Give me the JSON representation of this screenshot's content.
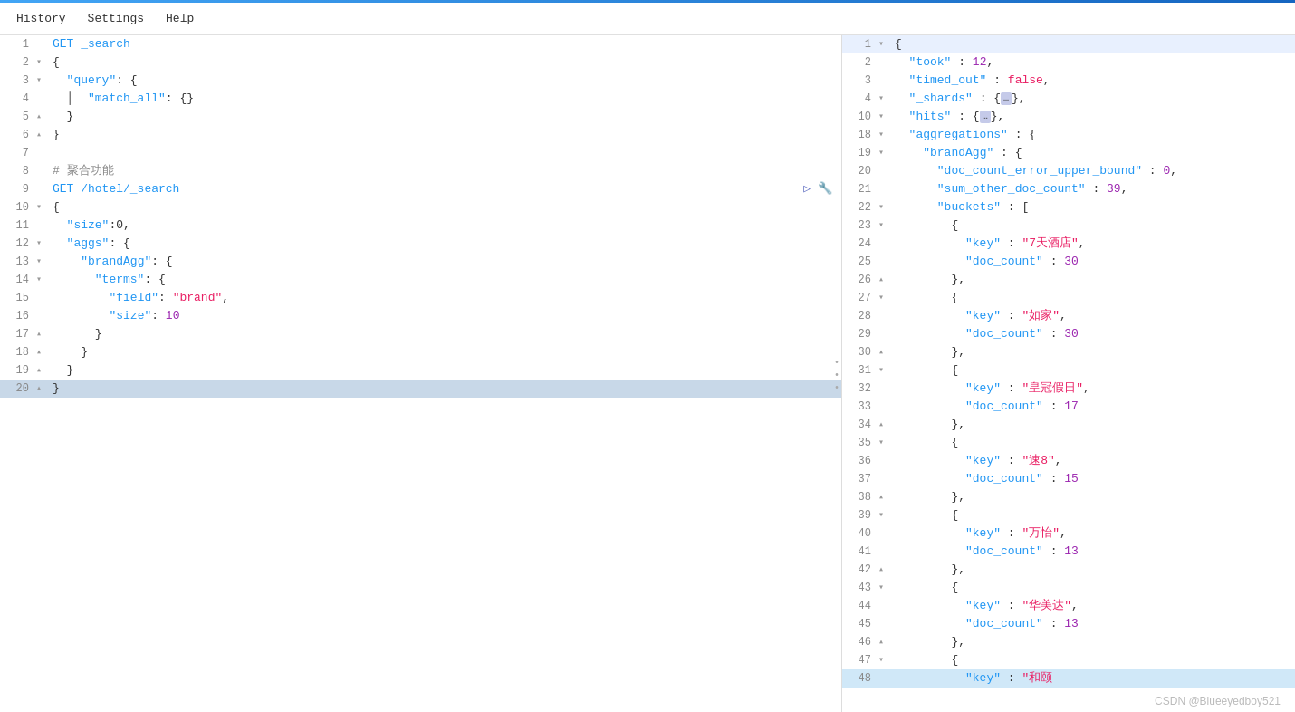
{
  "menu": {
    "items": [
      "History",
      "Settings",
      "Help"
    ]
  },
  "editor": {
    "lines": [
      {
        "num": 1,
        "fold": " ",
        "content": "GET _search",
        "type": "method"
      },
      {
        "num": 2,
        "fold": "▾",
        "content": "{",
        "type": "brace"
      },
      {
        "num": 3,
        "fold": "▾",
        "content": "  \"query\": {",
        "type": "key"
      },
      {
        "num": 4,
        "fold": " ",
        "content": "    \"match_all\": {}",
        "type": "key"
      },
      {
        "num": 5,
        "fold": "▴",
        "content": "  }",
        "type": "brace"
      },
      {
        "num": 6,
        "fold": "▴",
        "content": "}",
        "type": "brace"
      },
      {
        "num": 7,
        "fold": " ",
        "content": "",
        "type": "empty"
      },
      {
        "num": 8,
        "fold": " ",
        "content": "# 聚合功能",
        "type": "comment"
      },
      {
        "num": 9,
        "fold": " ",
        "content": "GET /hotel/_search",
        "type": "method",
        "hasIcons": true
      },
      {
        "num": 10,
        "fold": "▾",
        "content": "{",
        "type": "brace"
      },
      {
        "num": 11,
        "fold": " ",
        "content": "  \"size\":0,",
        "type": "key"
      },
      {
        "num": 12,
        "fold": "▾",
        "content": "  \"aggs\": {",
        "type": "key"
      },
      {
        "num": 13,
        "fold": "▾",
        "content": "    \"brandAgg\": {",
        "type": "key"
      },
      {
        "num": 14,
        "fold": "▾",
        "content": "      \"terms\": {",
        "type": "key"
      },
      {
        "num": 15,
        "fold": " ",
        "content": "        \"field\": \"brand\",",
        "type": "key"
      },
      {
        "num": 16,
        "fold": " ",
        "content": "        \"size\": 10",
        "type": "key"
      },
      {
        "num": 17,
        "fold": "▴",
        "content": "      }",
        "type": "brace"
      },
      {
        "num": 18,
        "fold": "▴",
        "content": "    }",
        "type": "brace"
      },
      {
        "num": 19,
        "fold": "▴",
        "content": "  }",
        "type": "brace"
      },
      {
        "num": 20,
        "fold": "▴",
        "content": "}",
        "type": "brace",
        "highlighted": true
      }
    ]
  },
  "response": {
    "lines": [
      {
        "num": 1,
        "fold": "▾",
        "content": "{"
      },
      {
        "num": 2,
        "fold": " ",
        "content": "  \"took\" : 12,"
      },
      {
        "num": 3,
        "fold": " ",
        "content": "  \"timed_out\" : false,"
      },
      {
        "num": 4,
        "fold": "▾",
        "content": "  \"_shards\" : {…},"
      },
      {
        "num": 10,
        "fold": "▾",
        "content": "  \"hits\" : {…},"
      },
      {
        "num": 18,
        "fold": "▾",
        "content": "  \"aggregations\" : {"
      },
      {
        "num": 19,
        "fold": "▾",
        "content": "    \"brandAgg\" : {"
      },
      {
        "num": 20,
        "fold": " ",
        "content": "      \"doc_count_error_upper_bound\" : 0,"
      },
      {
        "num": 21,
        "fold": " ",
        "content": "      \"sum_other_doc_count\" : 39,"
      },
      {
        "num": 22,
        "fold": "▾",
        "content": "      \"buckets\" : ["
      },
      {
        "num": 23,
        "fold": "▾",
        "content": "        {"
      },
      {
        "num": 24,
        "fold": " ",
        "content": "          \"key\" : \"7天酒店\","
      },
      {
        "num": 25,
        "fold": " ",
        "content": "          \"doc_count\" : 30"
      },
      {
        "num": 26,
        "fold": "▴",
        "content": "        },"
      },
      {
        "num": 27,
        "fold": "▾",
        "content": "        {"
      },
      {
        "num": 28,
        "fold": " ",
        "content": "          \"key\" : \"如家\","
      },
      {
        "num": 29,
        "fold": " ",
        "content": "          \"doc_count\" : 30"
      },
      {
        "num": 30,
        "fold": "▴",
        "content": "        },"
      },
      {
        "num": 31,
        "fold": "▾",
        "content": "        {"
      },
      {
        "num": 32,
        "fold": " ",
        "content": "          \"key\" : \"皇冠假日\","
      },
      {
        "num": 33,
        "fold": " ",
        "content": "          \"doc_count\" : 17"
      },
      {
        "num": 34,
        "fold": "▴",
        "content": "        },"
      },
      {
        "num": 35,
        "fold": "▾",
        "content": "        {"
      },
      {
        "num": 36,
        "fold": " ",
        "content": "          \"key\" : \"速8\","
      },
      {
        "num": 37,
        "fold": " ",
        "content": "          \"doc_count\" : 15"
      },
      {
        "num": 38,
        "fold": "▴",
        "content": "        },"
      },
      {
        "num": 39,
        "fold": "▾",
        "content": "        {"
      },
      {
        "num": 40,
        "fold": " ",
        "content": "          \"key\" : \"万怡\","
      },
      {
        "num": 41,
        "fold": " ",
        "content": "          \"doc_count\" : 13"
      },
      {
        "num": 42,
        "fold": "▴",
        "content": "        },"
      },
      {
        "num": 43,
        "fold": "▾",
        "content": "        {"
      },
      {
        "num": 44,
        "fold": " ",
        "content": "          \"key\" : \"华美达\","
      },
      {
        "num": 45,
        "fold": " ",
        "content": "          \"doc_count\" : 13"
      },
      {
        "num": 46,
        "fold": "▴",
        "content": "        },"
      },
      {
        "num": 47,
        "fold": "▾",
        "content": "        {"
      },
      {
        "num": 48,
        "fold": " ",
        "content": "          \"key\" : \"和颐\","
      }
    ]
  },
  "watermark": "CSDN @Blueeyedboy521"
}
